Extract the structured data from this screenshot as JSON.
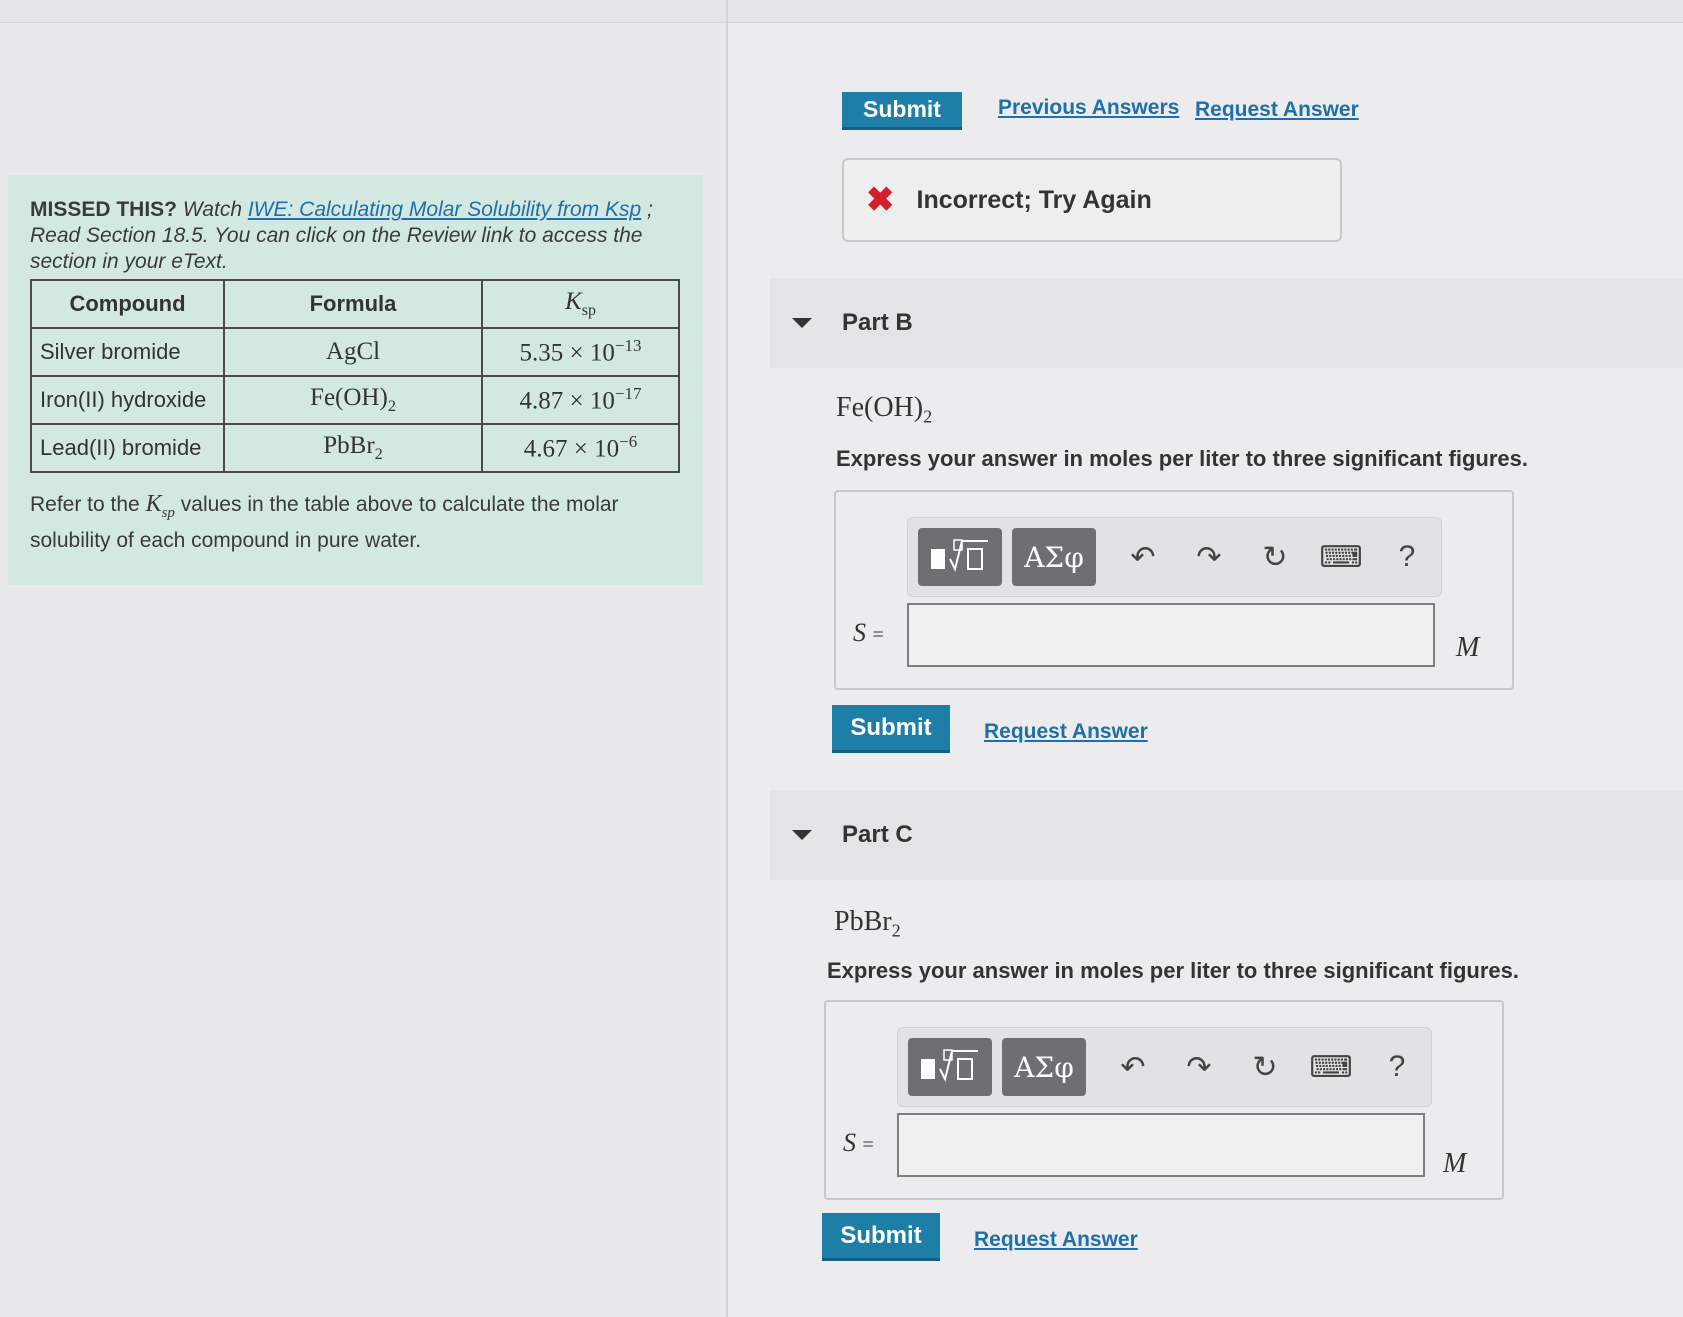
{
  "top_actions": {
    "submit_label": "Submit",
    "previous_answers_label": "Previous Answers",
    "request_answer_label": "Request Answer"
  },
  "feedback": {
    "icon": "x-icon",
    "text": "Incorrect; Try Again"
  },
  "info_panel": {
    "missed_label": "MISSED THIS?",
    "watch_text": "Watch",
    "link_text": "IWE: Calculating Molar Solubility from Ksp",
    "after_link": "; Read Section 18.5. You can click on the Review link to access the section in your eText.",
    "table": {
      "headers": [
        "Compound",
        "Formula",
        "Ksp"
      ],
      "rows": [
        {
          "compound": "Silver bromide",
          "formula": "AgCl",
          "ksp_mantissa": "5.35",
          "ksp_exponent": "−13"
        },
        {
          "compound": "Iron(II) hydroxide",
          "formula": "Fe(OH)2",
          "ksp_mantissa": "4.87",
          "ksp_exponent": "−17"
        },
        {
          "compound": "Lead(II) bromide",
          "formula": "PbBr2",
          "ksp_mantissa": "4.67",
          "ksp_exponent": "−6"
        }
      ]
    },
    "refer_before": "Refer to the",
    "refer_symbol": "Ksp",
    "refer_after": "values in the table above to calculate the molar solubility of each compound in pure water."
  },
  "parts": [
    {
      "label": "Part B",
      "formula": "Fe(OH)2",
      "instruction": "Express your answer in moles per liter to three significant figures.",
      "variable": "S",
      "equals": "=",
      "unit": "M",
      "input_value": "",
      "submit_label": "Submit",
      "request_answer_label": "Request Answer"
    },
    {
      "label": "Part C",
      "formula": "PbBr2",
      "instruction": "Express your answer in moles per liter to three significant figures.",
      "variable": "S",
      "equals": "=",
      "unit": "M",
      "input_value": "",
      "submit_label": "Submit",
      "request_answer_label": "Request Answer"
    }
  ],
  "toolbar": {
    "templates_icon": "math-templates-icon",
    "symbols_label": "ΑΣφ",
    "undo_icon": "undo-icon",
    "redo_icon": "redo-icon",
    "reset_icon": "reset-icon",
    "keyboard_icon": "keyboard-icon",
    "help_label": "?"
  },
  "colors": {
    "button": "#1d7fa8",
    "link": "#1f6fa8",
    "error": "#d21f2a",
    "info_panel": "#d4e8e2"
  }
}
